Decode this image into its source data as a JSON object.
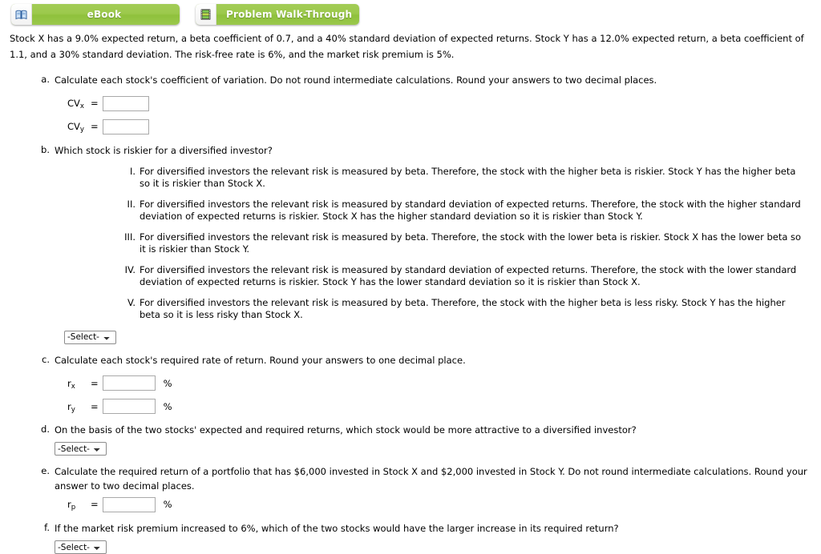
{
  "toolbar": {
    "buttons": [
      {
        "id": "ebook",
        "label": "eBook",
        "icon": "book-icon",
        "color": "#9cc94c"
      },
      {
        "id": "walkthrough",
        "label": "Problem Walk-Through",
        "icon": "film-strip-icon",
        "color": "#9cc94c"
      }
    ]
  },
  "problem": {
    "intro": "Stock X has a 9.0% expected return, a beta coefficient of 0.7, and a 40% standard deviation of expected returns. Stock Y has a 12.0% expected return, a beta coefficient of 1.1, and a 30% standard deviation. The risk-free rate is 6%, and the market risk premium is 5%."
  },
  "parts": {
    "a": {
      "marker": "a.",
      "text": "Calculate each stock's coefficient of variation. Do not round intermediate calculations. Round your answers to two decimal places.",
      "inputs": [
        {
          "label": "CV",
          "sub": "x",
          "eq": "=",
          "value": "",
          "suffix": ""
        },
        {
          "label": "CV",
          "sub": "y",
          "eq": "=",
          "value": "",
          "suffix": ""
        }
      ]
    },
    "b": {
      "marker": "b.",
      "text": "Which stock is riskier for a diversified investor?",
      "options": [
        {
          "numeral": "I.",
          "text": "For diversified investors the relevant risk is measured by beta. Therefore, the stock with the higher beta is riskier. Stock Y has the higher beta so it is riskier than Stock X."
        },
        {
          "numeral": "II.",
          "text": "For diversified investors the relevant risk is measured by standard deviation of expected returns. Therefore, the stock with the higher standard deviation of expected returns is riskier. Stock X has the higher standard deviation so it is riskier than Stock Y."
        },
        {
          "numeral": "III.",
          "text": "For diversified investors the relevant risk is measured by beta. Therefore, the stock with the lower beta is riskier. Stock X has the lower beta so it is riskier than Stock Y."
        },
        {
          "numeral": "IV.",
          "text": "For diversified investors the relevant risk is measured by standard deviation of expected returns. Therefore, the stock with the lower standard deviation of expected returns is riskier. Stock Y has the lower standard deviation so it is riskier than Stock X."
        },
        {
          "numeral": "V.",
          "text": "For diversified investors the relevant risk is measured by beta. Therefore, the stock with the higher beta is less risky. Stock Y has the higher beta so it is less risky than Stock X."
        }
      ],
      "select": {
        "value": "-Select-",
        "options": [
          "-Select-",
          "I",
          "II",
          "III",
          "IV",
          "V"
        ]
      }
    },
    "c": {
      "marker": "c.",
      "text": "Calculate each stock's required rate of return. Round your answers to one decimal place.",
      "inputs": [
        {
          "label": "r",
          "sub": "x",
          "eq": "=",
          "value": "",
          "suffix": "%"
        },
        {
          "label": "r",
          "sub": "y",
          "eq": "=",
          "value": "",
          "suffix": "%"
        }
      ]
    },
    "d": {
      "marker": "d.",
      "text": "On the basis of the two stocks' expected and required returns, which stock would be more attractive to a diversified investor?",
      "select": {
        "value": "-Select-",
        "options": [
          "-Select-",
          "Stock X",
          "Stock Y"
        ]
      }
    },
    "e": {
      "marker": "e.",
      "text": "Calculate the required return of a portfolio that has $6,000 invested in Stock X and $2,000 invested in Stock Y. Do not round intermediate calculations. Round your answer to two decimal places.",
      "inputs": [
        {
          "label": "r",
          "sub": "p",
          "eq": "=",
          "value": "",
          "suffix": "%"
        }
      ]
    },
    "f": {
      "marker": "f.",
      "text": "If the market risk premium increased to 6%, which of the two stocks would have the larger increase in its required return?",
      "select": {
        "value": "-Select-",
        "options": [
          "-Select-",
          "Stock X",
          "Stock Y"
        ]
      }
    }
  }
}
